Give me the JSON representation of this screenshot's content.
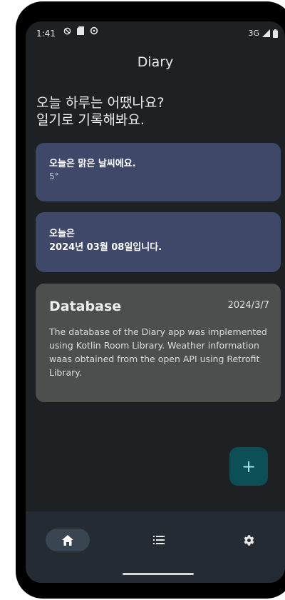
{
  "status_bar": {
    "time": "1:41",
    "network": "3G"
  },
  "app": {
    "title": "Diary"
  },
  "greeting": {
    "line1": "오늘 하루는 어땠나요?",
    "line2": "일기로 기록해봐요."
  },
  "weather_card": {
    "text": "오늘은 맑은 날씨에요.",
    "temperature": "5°"
  },
  "date_card": {
    "line1": "오늘은",
    "line2": "2024년 03월 08일입니다."
  },
  "entry_card": {
    "title": "Database",
    "date": "2024/3/7",
    "body": "The database of the Diary app was implemented using Kotlin Room Library. Weather information waas obtained from the open API using Retrofit Library."
  },
  "fab": {
    "label": "+"
  },
  "bottom_nav": {
    "items": [
      {
        "icon": "home-icon"
      },
      {
        "icon": "list-icon"
      },
      {
        "icon": "gear-icon"
      }
    ]
  },
  "colors": {
    "background": "#1e2124",
    "card_primary": "#3f4868",
    "card_entry": "#4b504f",
    "fab": "#0c4f56",
    "nav": "#252b33"
  }
}
